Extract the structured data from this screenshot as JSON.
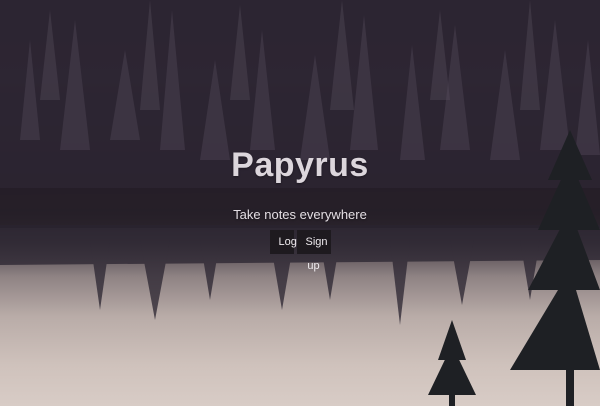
{
  "hero": {
    "title": "Papyrus",
    "tagline": "Take notes everywhere",
    "background": "forest-lake-reflection-photo"
  },
  "actions": {
    "login_label": "Login",
    "signup_label": "Sign up"
  },
  "colors": {
    "button_bg": "#1e1a1f",
    "title_color": "#dcd6dc",
    "forest_dark": "#2b2430",
    "lake_light": "#d8ccc6"
  }
}
